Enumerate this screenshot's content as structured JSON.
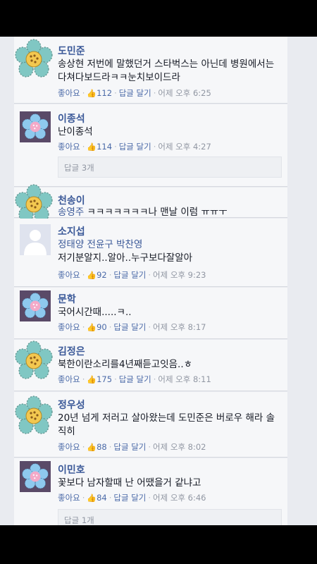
{
  "comments": [
    {
      "name": "도민준",
      "text": "송상현 저번에 말했던거 스타벅스는 아닌데 병원에서는 다쳐다보드라ㅋㅋ눈치보이드라",
      "like_label": "좋아요",
      "likes": "112",
      "reply_label": "답글 달기",
      "time": "어제 오후 6:25",
      "avatar_icon": "flower-sticker-icon"
    },
    {
      "name": "이종석",
      "text": "난이종석",
      "like_label": "좋아요",
      "likes": "114",
      "reply_label": "답글 달기",
      "time": "어제 오후 4:27",
      "replies": "답글 3개",
      "avatar_icon": "flower-sticker-icon"
    },
    {
      "name": "천송이",
      "tag": "송영주",
      "text": " ㅋㅋㅋㅋㅋㅋㅋ나 맨날 이럼 ㅠㅠㅜ",
      "avatar_icon": "flower-sticker-icon"
    },
    {
      "name": "소지섭",
      "tags": "정태양 전윤구 박찬영",
      "text": "저기분알지..알아..누구보다잘알아",
      "like_label": "좋아요",
      "likes": "92",
      "reply_label": "답글 달기",
      "time": "어제 오후 9:23",
      "avatar_icon": "default-avatar-icon"
    },
    {
      "name": "문학",
      "text": "국어시간때.....ㅋ..",
      "like_label": "좋아요",
      "likes": "90",
      "reply_label": "답글 달기",
      "time": "어제 오후 8:17",
      "avatar_icon": "flower-sticker-icon"
    },
    {
      "name": "김정은",
      "text": "북한이란소리를4년째듣고잇음..ㅎ",
      "like_label": "좋아요",
      "likes": "175",
      "reply_label": "답글 달기",
      "time": "어제 오후 8:11",
      "avatar_icon": "flower-sticker-icon"
    },
    {
      "name": "정우성",
      "text": "20년 넘게 저러고 살아왔는데 도민준은 버로우 해라 솔직히",
      "like_label": "좋아요",
      "likes": "88",
      "reply_label": "답글 달기",
      "time": "어제 오후 8:02",
      "avatar_icon": "flower-sticker-icon"
    },
    {
      "name": "이민호",
      "text": "꽃보다 남자할때 난 어땠을거 같냐고",
      "like_label": "좋아요",
      "likes": "84",
      "reply_label": "답글 달기",
      "time": "어제 오후 6:46",
      "replies": "답글 1개",
      "avatar_icon": "flower-sticker-icon"
    }
  ],
  "colors": {
    "name": "#3b5998",
    "text": "#141823",
    "meta": "#9197a3",
    "flower_petal": "#7fc6c4",
    "flower_center": "#f2c94c"
  }
}
